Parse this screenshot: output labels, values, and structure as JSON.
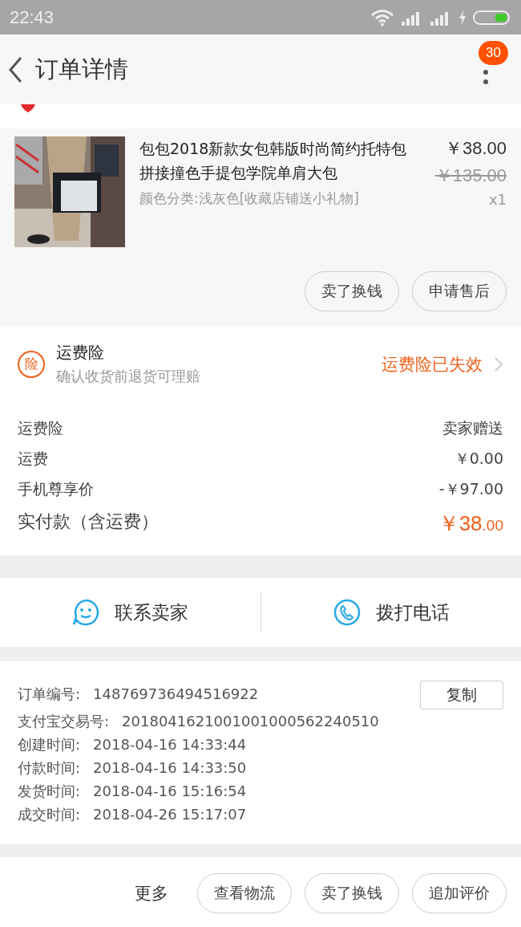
{
  "status_bar": {
    "time": "22:43"
  },
  "header": {
    "title": "订单详情",
    "badge": "30"
  },
  "product": {
    "title": "包包2018新款女包韩版时尚简约托特包拼接撞色手提包学院单肩大包",
    "sku": "颜色分类:浅灰色[收藏店铺送小礼物]",
    "price": "￥38.00",
    "original_price": "￥135.00",
    "quantity": "x1",
    "actions": [
      "卖了换钱",
      "申请售后"
    ]
  },
  "insurance": {
    "icon_text": "险",
    "title": "运费险",
    "subtitle": "确认收货前退货可理赔",
    "status": "运费险已失效"
  },
  "fees": [
    {
      "label": "运费险",
      "value": "卖家赠送",
      "kind": "plain"
    },
    {
      "label": "运费",
      "value": "￥0.00",
      "kind": "plain"
    },
    {
      "label": "手机尊享价",
      "value": "-￥97.00",
      "kind": "plain"
    },
    {
      "label": "实付款（含运费）",
      "value": "￥38",
      "decimals": ".00",
      "kind": "total"
    }
  ],
  "contact": [
    {
      "label": "联系卖家",
      "kind": "chat"
    },
    {
      "label": "拨打电话",
      "kind": "phone"
    }
  ],
  "order_info": {
    "copy_button": "复制",
    "rows": [
      {
        "label": "订单编号:",
        "value": "148769736494516922"
      },
      {
        "label": "支付宝交易号:",
        "value": "2018041621001001000562240510"
      },
      {
        "label": "创建时间:",
        "value": "2018-04-16 14:33:44"
      },
      {
        "label": "付款时间:",
        "value": "2018-04-16 14:33:50"
      },
      {
        "label": "发货时间:",
        "value": "2018-04-16 15:16:54"
      },
      {
        "label": "成交时间:",
        "value": "2018-04-26 15:17:07"
      }
    ]
  },
  "bottom_bar": {
    "more": "更多",
    "buttons": [
      "查看物流",
      "卖了换钱",
      "追加评价"
    ]
  }
}
